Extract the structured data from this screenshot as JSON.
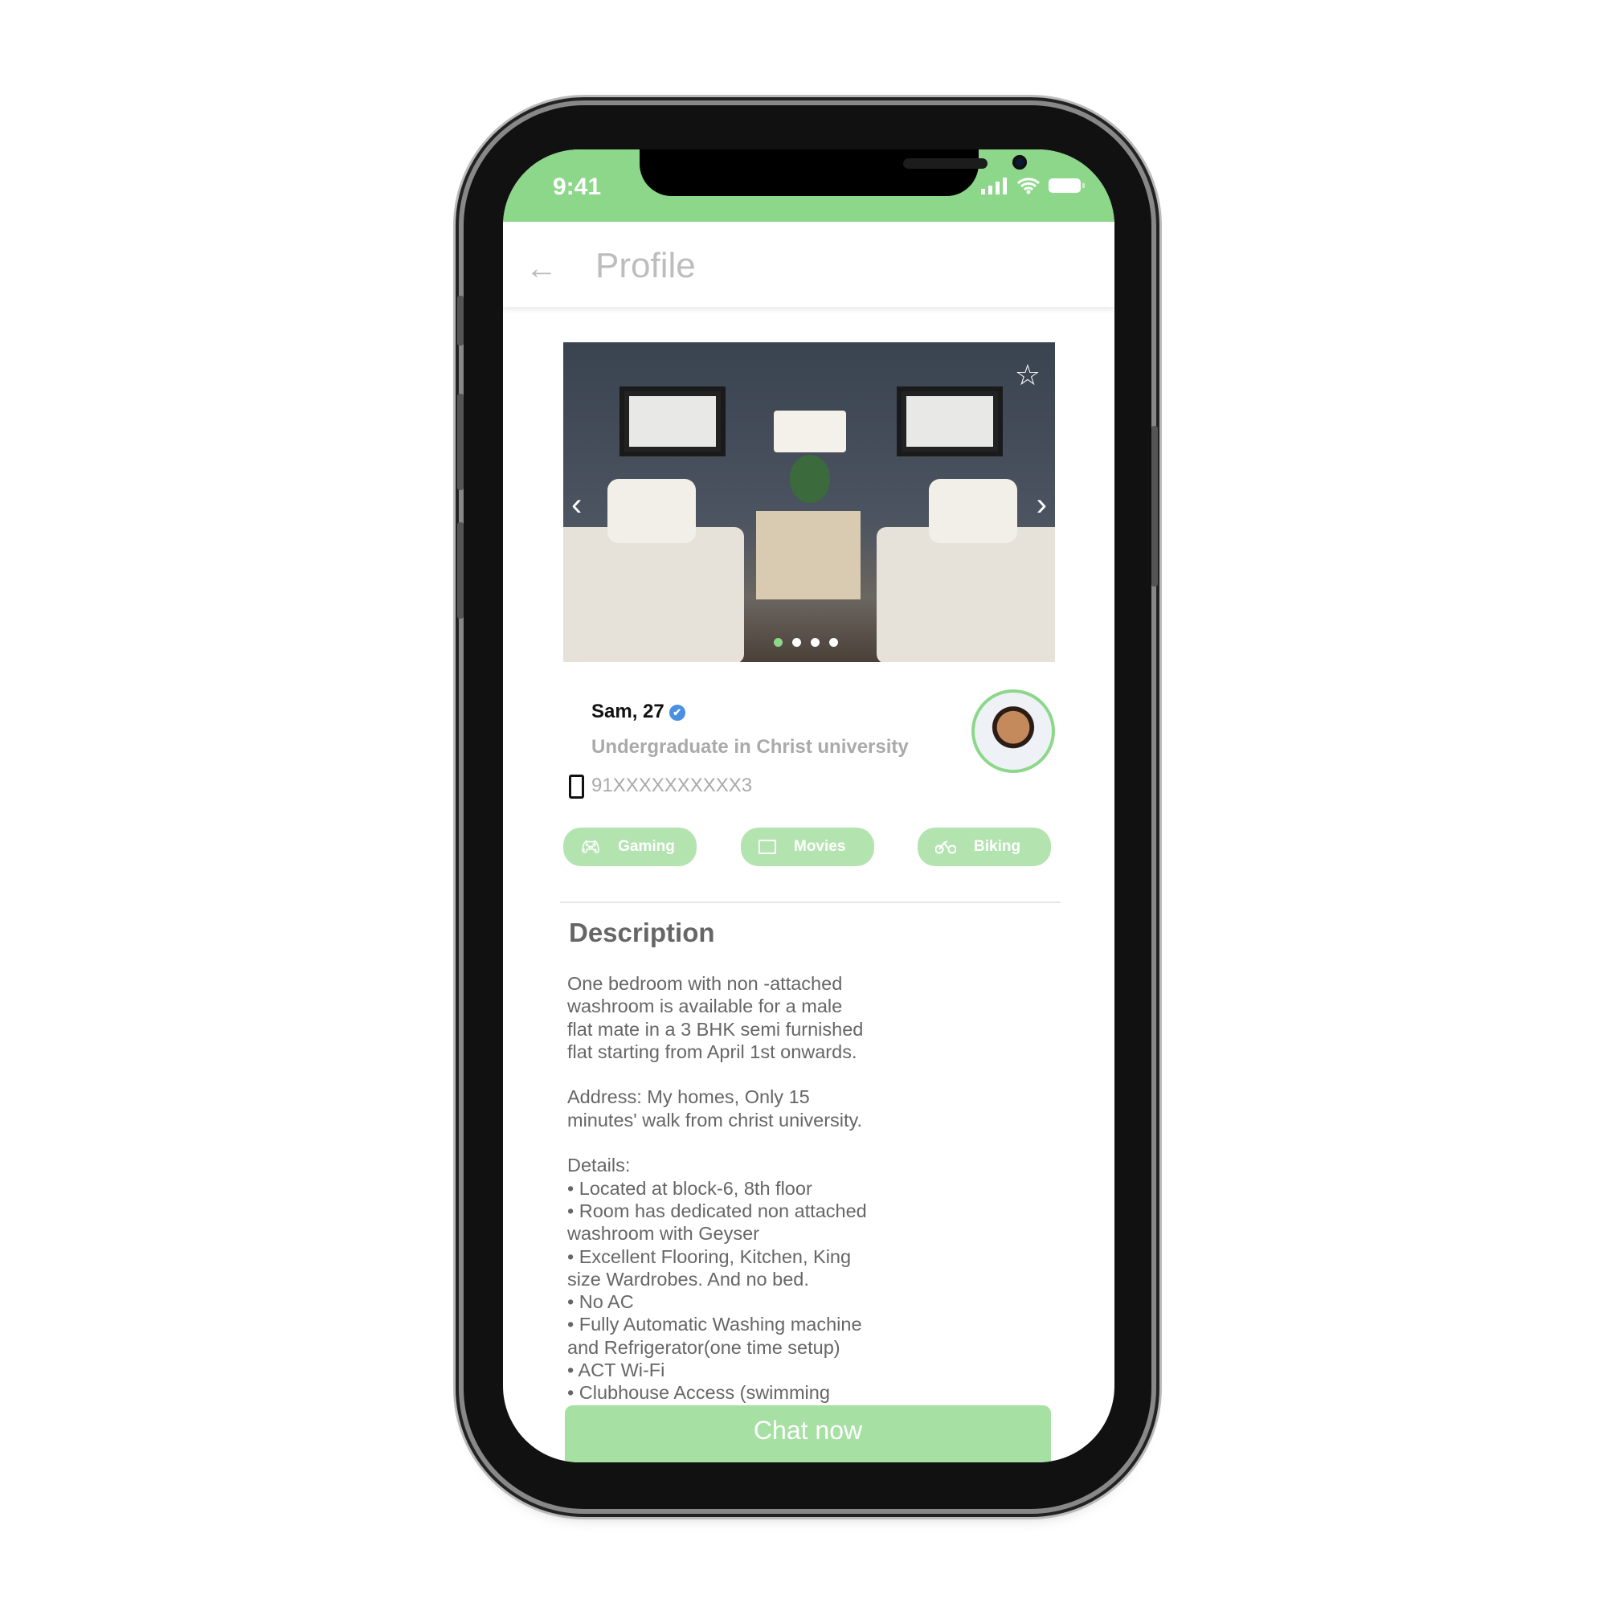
{
  "status_bar": {
    "time": "9:41",
    "icons": [
      "signal-icon",
      "wifi-icon",
      "battery-icon"
    ]
  },
  "header": {
    "title": "Profile",
    "back_icon": "arrow-left-icon"
  },
  "gallery": {
    "image_count": 4,
    "active_index": 0,
    "favorite_icon": "star-outline-icon"
  },
  "profile": {
    "name": "Sam, 27",
    "verified_icon": "✔",
    "subtitle": "Undergraduate in Christ university",
    "phone": "91XXXXXXXXXX3"
  },
  "interests": [
    {
      "label": "Gaming",
      "icon": "gamepad-icon"
    },
    {
      "label": "Movies",
      "icon": "monitor-icon"
    },
    {
      "label": "Biking",
      "icon": "bicycle-icon"
    }
  ],
  "description": {
    "heading": "Description",
    "body": "One bedroom with non -attached\nwashroom is available for a male\nflat mate in a 3 BHK semi furnished\nflat starting from April 1st onwards.\n\nAddress: My homes, Only 15\nminutes' walk from christ university.\n\nDetails:\n• Located at block-6, 8th floor\n• Room has dedicated non attached\nwashroom with Geyser\n• Excellent Flooring, Kitchen, King\nsize Wardrobes. And no bed.\n• No AC\n• Fully Automatic Washing machine\nand Refrigerator(one time setup)\n• ACT Wi-Fi\n• Clubhouse Access (swimming"
  },
  "cta": {
    "label": "Chat now"
  },
  "colors": {
    "accent": "#8dd78a",
    "chip": "#b3e4b0",
    "cta": "#a6e0a3"
  }
}
